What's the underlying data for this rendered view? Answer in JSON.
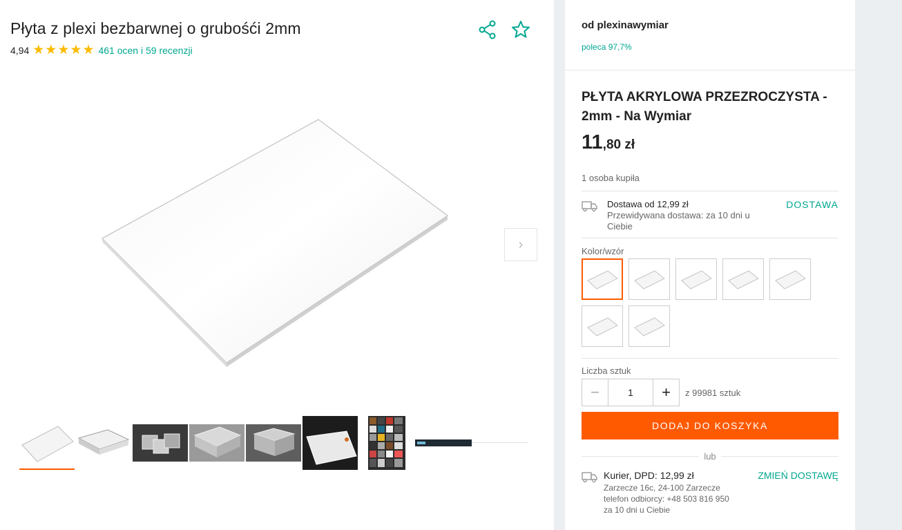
{
  "product": {
    "title": "Płyta z plexi bezbarwnej o grubośći 2mm",
    "rating_value": "4,94",
    "rating_stars": 5,
    "rating_link": "461 ocen i 59 recenzji"
  },
  "seller": {
    "name": "od plexinawymiar",
    "recommend": "poleca 97,7%"
  },
  "offer": {
    "name": "PŁYTA AKRYLOWA PRZEZROCZYSTA - 2mm - Na Wymiar",
    "price_main": "11",
    "price_rest": ",80 zł",
    "bought": "1 osoba kupiła"
  },
  "delivery": {
    "main": "Dostawa od 12,99 zł",
    "sub": "Przewidywana dostawa: za 10 dni u Ciebie",
    "link": "DOSTAWA"
  },
  "variants": {
    "label": "Kolor/wzór",
    "count": 7,
    "selected_index": 0
  },
  "quantity": {
    "label": "Liczba sztuk",
    "minus": "−",
    "value": "1",
    "plus": "+",
    "available": "z 99981 sztuk"
  },
  "cart": {
    "add_label": "DODAJ DO KOSZYKA"
  },
  "or_label": "lub",
  "courier": {
    "main": "Kurier, DPD: 12,99 zł",
    "address": "Zarzecze 16c, 24-100 Zarzecze",
    "phone": "telefon odbiorcy: +48 503 816 950",
    "eta": "za 10 dni u Ciebie",
    "link": "ZMIEŃ DOSTAWĘ"
  },
  "icons": {
    "share": "share-icon",
    "favorite": "star-outline-icon",
    "next": "chevron-right-icon",
    "truck": "truck-icon"
  },
  "colors": {
    "accent_orange": "#ff5a00",
    "accent_teal": "#00a790",
    "star_yellow": "#fabb00"
  }
}
